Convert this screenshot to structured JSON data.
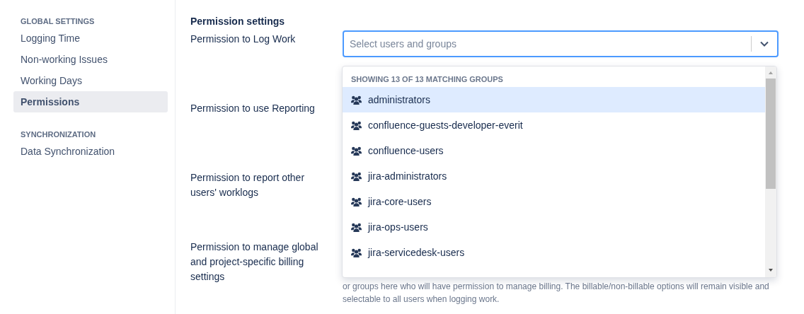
{
  "sidebar": {
    "sections": [
      {
        "heading": "GLOBAL SETTINGS",
        "items": [
          {
            "label": "Logging Time",
            "selected": false
          },
          {
            "label": "Non-working Issues",
            "selected": false
          },
          {
            "label": "Working Days",
            "selected": false
          },
          {
            "label": "Permissions",
            "selected": true
          }
        ]
      },
      {
        "heading": "SYNCHRONIZATION",
        "items": [
          {
            "label": "Data Synchronization",
            "selected": false
          }
        ]
      }
    ]
  },
  "main": {
    "title": "Permission settings",
    "permissions": [
      {
        "label": "Permission to Log Work"
      },
      {
        "label": "Permission to use Reporting"
      },
      {
        "label": "Permission to report other users' worklogs"
      },
      {
        "label": "Permission to manage global and project-specific billing settings",
        "help": "or groups here who will have permission to manage billing. The billable/non-billable options will remain visible and selectable to all users when logging work."
      }
    ],
    "select": {
      "placeholder": "Select users and groups"
    },
    "dropdown": {
      "header": "SHOWING 13 OF 13 MATCHING GROUPS",
      "options": [
        {
          "label": "administrators",
          "selected": true
        },
        {
          "label": "confluence-guests-developer-everit",
          "selected": false
        },
        {
          "label": "confluence-users",
          "selected": false
        },
        {
          "label": "jira-administrators",
          "selected": false
        },
        {
          "label": "jira-core-users",
          "selected": false
        },
        {
          "label": "jira-ops-users",
          "selected": false
        },
        {
          "label": "jira-servicedesk-users",
          "selected": false
        }
      ]
    }
  }
}
